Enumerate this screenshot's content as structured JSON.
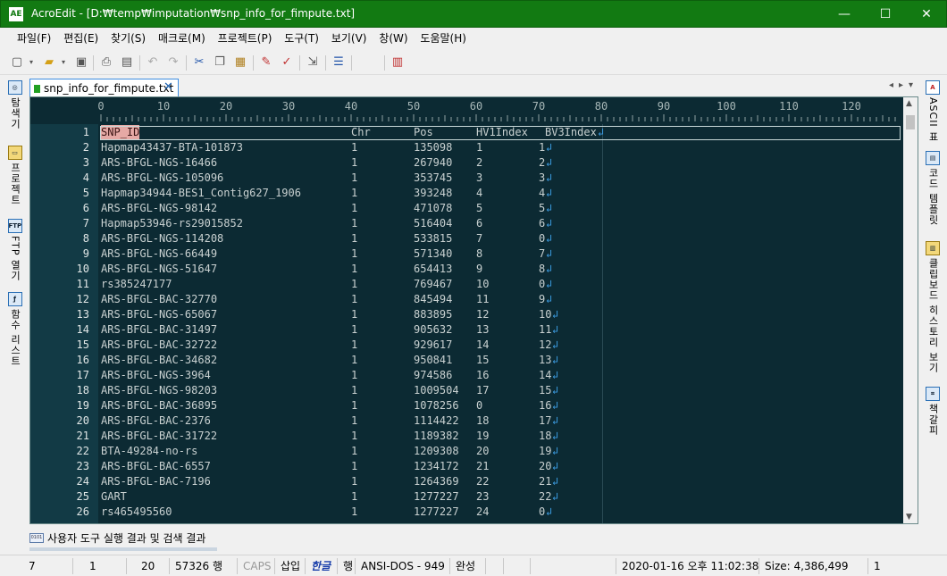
{
  "window": {
    "app_icon": "AE",
    "title": "AcroEdit - [D:₩temp₩imputation₩snp_info_for_fimpute.txt]",
    "minimize": "—",
    "maximize": "☐",
    "close": "✕"
  },
  "menu": [
    "파일(F)",
    "편집(E)",
    "찾기(S)",
    "매크로(M)",
    "프로젝트(P)",
    "도구(T)",
    "보기(V)",
    "창(W)",
    "도움말(H)"
  ],
  "left_tabs": [
    {
      "label": "탐색기",
      "icon": "folder-search-icon"
    },
    {
      "label": "프로젝트",
      "icon": "project-icon"
    },
    {
      "label": "FTP 열기",
      "icon": "ftp-icon",
      "icon_text": "FTP"
    },
    {
      "label": "함수 리스트",
      "icon": "function-list-icon"
    }
  ],
  "right_tabs": [
    {
      "label": "ASCII 표",
      "icon": "ascii-icon",
      "icon_text": "A"
    },
    {
      "label": "코드 템플릿",
      "icon": "code-template-icon"
    },
    {
      "label": "클립보드 히스토리 보기",
      "icon": "clipboard-icon"
    },
    {
      "label": "책갈피",
      "icon": "bookmark-icon"
    }
  ],
  "document_tab": {
    "label": "snp_info_for_fimpute.txt",
    "close": "✕"
  },
  "tab_nav": "◂▸▾",
  "ruler": [
    "0",
    "10",
    "20",
    "30",
    "40",
    "50",
    "60",
    "70",
    "80",
    "90",
    "100",
    "110",
    "120"
  ],
  "editor": {
    "eol_glyph": "↲",
    "header": {
      "line": "1",
      "snp": "SNP_ID",
      "chr": "Chr",
      "pos": "Pos",
      "hv": "HV1Index",
      "bv": "BV3Index"
    },
    "rows": [
      {
        "line": "2",
        "snp": "Hapmap43437-BTA-101873",
        "chr": "1",
        "pos": "135098",
        "hv": "1",
        "bv": "1"
      },
      {
        "line": "3",
        "snp": "ARS-BFGL-NGS-16466",
        "chr": "1",
        "pos": "267940",
        "hv": "2",
        "bv": "2"
      },
      {
        "line": "4",
        "snp": "ARS-BFGL-NGS-105096",
        "chr": "1",
        "pos": "353745",
        "hv": "3",
        "bv": "3"
      },
      {
        "line": "5",
        "snp": "Hapmap34944-BES1_Contig627_1906",
        "chr": "1",
        "pos": "393248",
        "hv": "4",
        "bv": "4"
      },
      {
        "line": "6",
        "snp": "ARS-BFGL-NGS-98142",
        "chr": "1",
        "pos": "471078",
        "hv": "5",
        "bv": "5"
      },
      {
        "line": "7",
        "snp": "Hapmap53946-rs29015852",
        "chr": "1",
        "pos": "516404",
        "hv": "6",
        "bv": "6"
      },
      {
        "line": "8",
        "snp": "ARS-BFGL-NGS-114208",
        "chr": "1",
        "pos": "533815",
        "hv": "7",
        "bv": "0"
      },
      {
        "line": "9",
        "snp": "ARS-BFGL-NGS-66449",
        "chr": "1",
        "pos": "571340",
        "hv": "8",
        "bv": "7"
      },
      {
        "line": "10",
        "snp": "ARS-BFGL-NGS-51647",
        "chr": "1",
        "pos": "654413",
        "hv": "9",
        "bv": "8"
      },
      {
        "line": "11",
        "snp": "rs385247177",
        "chr": "1",
        "pos": "769467",
        "hv": "10",
        "bv": "0"
      },
      {
        "line": "12",
        "snp": "ARS-BFGL-BAC-32770",
        "chr": "1",
        "pos": "845494",
        "hv": "11",
        "bv": "9"
      },
      {
        "line": "13",
        "snp": "ARS-BFGL-NGS-65067",
        "chr": "1",
        "pos": "883895",
        "hv": "12",
        "bv": "10"
      },
      {
        "line": "14",
        "snp": "ARS-BFGL-BAC-31497",
        "chr": "1",
        "pos": "905632",
        "hv": "13",
        "bv": "11"
      },
      {
        "line": "15",
        "snp": "ARS-BFGL-BAC-32722",
        "chr": "1",
        "pos": "929617",
        "hv": "14",
        "bv": "12"
      },
      {
        "line": "16",
        "snp": "ARS-BFGL-BAC-34682",
        "chr": "1",
        "pos": "950841",
        "hv": "15",
        "bv": "13"
      },
      {
        "line": "17",
        "snp": "ARS-BFGL-NGS-3964",
        "chr": "1",
        "pos": "974586",
        "hv": "16",
        "bv": "14"
      },
      {
        "line": "18",
        "snp": "ARS-BFGL-NGS-98203",
        "chr": "1",
        "pos": "1009504",
        "hv": "17",
        "bv": "15"
      },
      {
        "line": "19",
        "snp": "ARS-BFGL-BAC-36895",
        "chr": "1",
        "pos": "1078256",
        "hv": "0",
        "bv": "16"
      },
      {
        "line": "20",
        "snp": "ARS-BFGL-BAC-2376",
        "chr": "1",
        "pos": "1114422",
        "hv": "18",
        "bv": "17"
      },
      {
        "line": "21",
        "snp": "ARS-BFGL-BAC-31722",
        "chr": "1",
        "pos": "1189382",
        "hv": "19",
        "bv": "18"
      },
      {
        "line": "22",
        "snp": "BTA-49284-no-rs",
        "chr": "1",
        "pos": "1209308",
        "hv": "20",
        "bv": "19"
      },
      {
        "line": "23",
        "snp": "ARS-BFGL-BAC-6557",
        "chr": "1",
        "pos": "1234172",
        "hv": "21",
        "bv": "20"
      },
      {
        "line": "24",
        "snp": "ARS-BFGL-BAC-7196",
        "chr": "1",
        "pos": "1264369",
        "hv": "22",
        "bv": "21"
      },
      {
        "line": "25",
        "snp": "GART",
        "chr": "1",
        "pos": "1277227",
        "hv": "23",
        "bv": "22"
      },
      {
        "line": "26",
        "snp": "rs465495560",
        "chr": "1",
        "pos": "1277227",
        "hv": "24",
        "bv": "0"
      }
    ]
  },
  "output": {
    "label": "사용자 도구 실행 결과 및 검색 결과",
    "icon_text": "0101"
  },
  "status": {
    "col": "7",
    "line": "1",
    "chars": "20",
    "lines": "57326 행",
    "caps": "CAPS",
    "insert": "삽입",
    "ime": "한글",
    "mode": "행",
    "encoding": "ANSI-DOS - 949",
    "complete": "완성",
    "datetime": "2020-01-16 오후 11:02:38",
    "size": "Size: 4,386,499",
    "tail": "1"
  },
  "colors": {
    "titlebar": "#127a12",
    "editor_bg": "#0c2a33",
    "gutter_bg": "#123a45",
    "highlight": "#e6a9a5",
    "eol": "#3b9be0"
  }
}
